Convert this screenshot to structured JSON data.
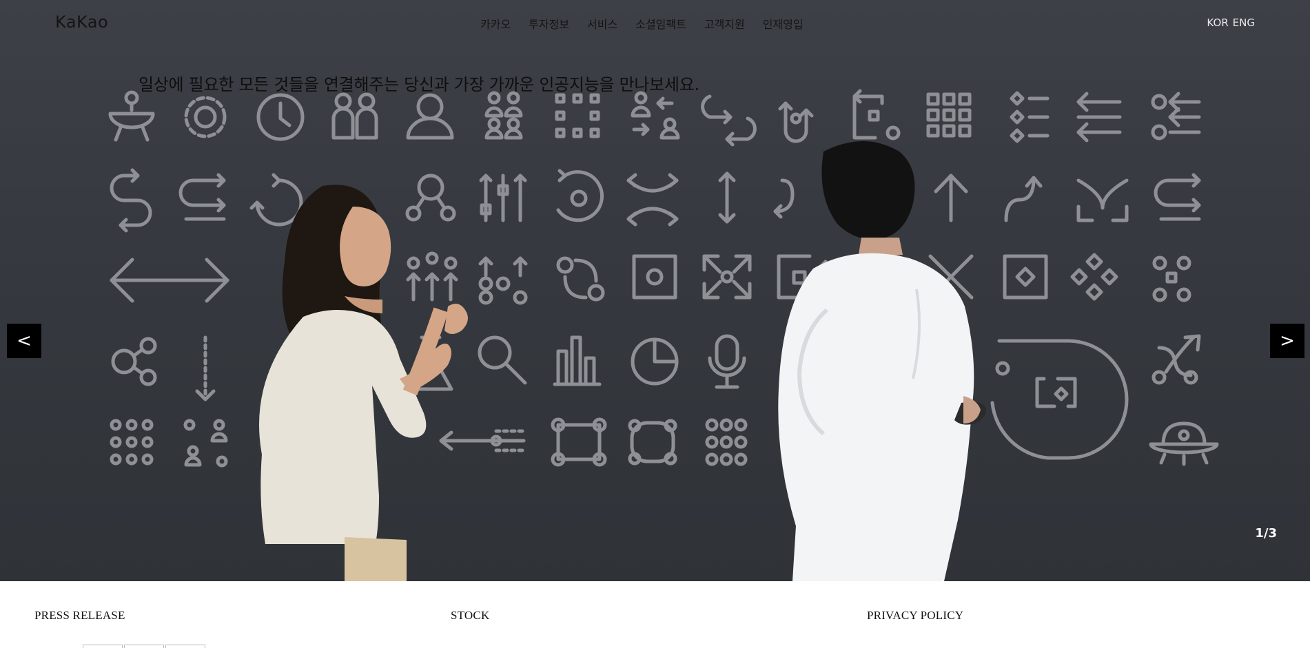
{
  "header": {
    "logo": "KaKao",
    "menu": [
      "카카오",
      "투자정보",
      "서비스",
      "소셜임팩트",
      "고객지원",
      "인재영입"
    ],
    "lang": [
      "KOR",
      "ENG"
    ]
  },
  "hero": {
    "tagline": "일상에 필요한 모든 것들을 연결해주는 당신과 가장 가까운 인공지능을 만나보세요.",
    "prev_label": "<",
    "next_label": ">",
    "slide_counter": "1/3",
    "colors": {
      "background": "#36393f",
      "icon_stroke": "#8e9095"
    }
  },
  "footer": {
    "press_release": "PRESS RELEASE",
    "stock": "STOCK",
    "privacy_policy": "PRIVACY POLICY"
  }
}
